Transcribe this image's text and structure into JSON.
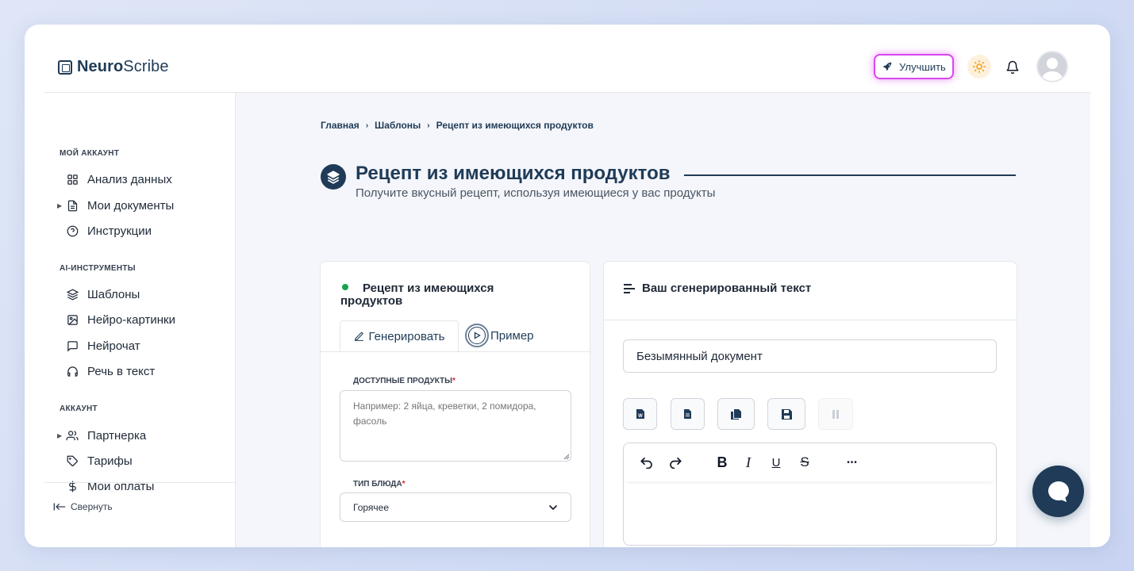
{
  "app": {
    "brand_bold": "Neuro",
    "brand_rest": "Scribe"
  },
  "header": {
    "upgrade_label": "Улучшить"
  },
  "sidebar": {
    "sections": [
      {
        "label": "Мой аккаунт"
      },
      {
        "label": "AI-инструменты"
      },
      {
        "label": "Аккаунт"
      }
    ],
    "items": [
      {
        "label": "Анализ данных",
        "icon": "grid-icon"
      },
      {
        "label": "Мои документы",
        "icon": "document-icon"
      },
      {
        "label": "Инструкции",
        "icon": "help-circle-icon"
      },
      {
        "label": "Шаблоны",
        "icon": "layers-icon"
      },
      {
        "label": "Нейро-картинки",
        "icon": "image-icon"
      },
      {
        "label": "Нейрочат",
        "icon": "chat-icon"
      },
      {
        "label": "Речь в текст",
        "icon": "headphones-icon"
      },
      {
        "label": "Партнерка",
        "icon": "users-icon"
      },
      {
        "label": "Тарифы",
        "icon": "tag-icon"
      },
      {
        "label": "Мои оплаты",
        "icon": "dollar-icon"
      }
    ],
    "collapse_label": "Свернуть"
  },
  "breadcrumb": [
    "Главная",
    "Шаблоны",
    "Рецепт из имеющихся продуктов"
  ],
  "page": {
    "title": "Рецепт из имеющихся продуктов",
    "subtitle": "Получите вкусный рецепт, используя имеющиеся у вас продукты"
  },
  "form": {
    "card_title": "Рецепт из имеющихся продуктов",
    "tab_generate": "Генерировать",
    "tab_example": "Пример",
    "products_label": "Доступные продукты",
    "products_placeholder": "Например: 2 яйца, креветки, 2 помидора, фасоль",
    "dish_type_label": "Тип блюда",
    "dish_type_value": "Горячее",
    "required_mark": "*"
  },
  "output": {
    "title": "Ваш сгенерированный текст",
    "doc_name": "Безымянный документ",
    "word_icon_letter": "W"
  },
  "editor": {
    "bold": "B",
    "italic": "I",
    "underline": "U",
    "strike": "S",
    "more": "•••"
  },
  "colors": {
    "primary": "#1f3b57",
    "accent_glow": "#d946ef",
    "status_green": "#16a34a",
    "required_red": "#dc2626"
  }
}
